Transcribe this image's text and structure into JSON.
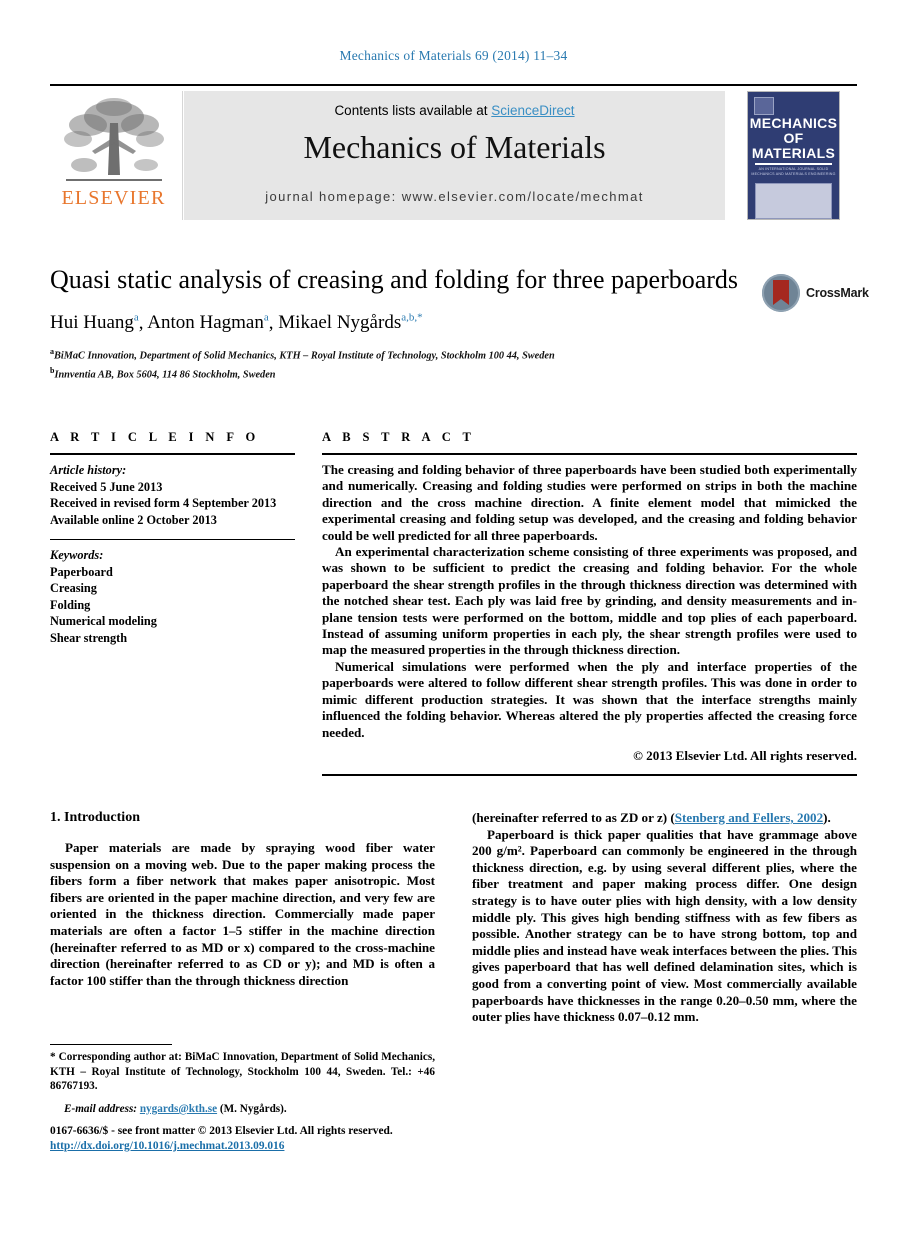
{
  "running_head": "Mechanics of Materials 69 (2014) 11–34",
  "masthead": {
    "contents_prefix": "Contents lists available at ",
    "sciencedirect": "ScienceDirect",
    "journal_title": "Mechanics of Materials",
    "homepage": "journal homepage: www.elsevier.com/locate/mechmat",
    "publisher_wordmark": "ELSEVIER",
    "cover": {
      "line1": "MECHANICS",
      "line2": "OF",
      "line3": "MATERIALS",
      "subtitle": "AN INTERNATIONAL JOURNAL\nSOLID MECHANICS AND MATERIALS ENGINEERING"
    }
  },
  "article": {
    "title": "Quasi static analysis of creasing and folding for three paperboards",
    "authors": [
      {
        "name": "Hui Huang",
        "marks": "a"
      },
      {
        "name": "Anton Hagman",
        "marks": "a"
      },
      {
        "name": "Mikael Nygårds",
        "marks": "a,b,*"
      }
    ],
    "affiliations": [
      {
        "mark": "a",
        "text": "BiMaC Innovation, Department of Solid Mechanics, KTH – Royal Institute of Technology, Stockholm 100 44, Sweden"
      },
      {
        "mark": "b",
        "text": "Innventia AB, Box 5604, 114 86 Stockholm, Sweden"
      }
    ],
    "crossmark_label": "CrossMark"
  },
  "info": {
    "heading": "A R T I C L E    I N F O",
    "history_label": "Article history:",
    "history": [
      "Received 5 June 2013",
      "Received in revised form 4 September 2013",
      "Available online 2 October 2013"
    ],
    "keywords_label": "Keywords:",
    "keywords": [
      "Paperboard",
      "Creasing",
      "Folding",
      "Numerical modeling",
      "Shear strength"
    ]
  },
  "abstract": {
    "heading": "A B S T R A C T",
    "paragraphs": [
      "The creasing and folding behavior of three paperboards have been studied both experimentally and numerically. Creasing and folding studies were performed on strips in both the machine direction and the cross machine direction. A finite element model that mimicked the experimental creasing and folding setup was developed, and the creasing and folding behavior could be well predicted for all three paperboards.",
      "An experimental characterization scheme consisting of three experiments was proposed, and was shown to be sufficient to predict the creasing and folding behavior. For the whole paperboard the shear strength profiles in the through thickness direction was determined with the notched shear test. Each ply was laid free by grinding, and density measurements and in-plane tension tests were performed on the bottom, middle and top plies of each paperboard. Instead of assuming uniform properties in each ply, the shear strength profiles were used to map the measured properties in the through thickness direction.",
      "Numerical simulations were performed when the ply and interface properties of the paperboards were altered to follow different shear strength profiles. This was done in order to mimic different production strategies. It was shown that the interface strengths mainly influenced the folding behavior. Whereas altered the ply properties affected the creasing force needed."
    ],
    "copyright": "© 2013 Elsevier Ltd. All rights reserved."
  },
  "body": {
    "section_title": "1. Introduction",
    "left_paragraph": "Paper materials are made by spraying wood fiber water suspension on a moving web. Due to the paper making process the fibers form a fiber network that makes paper anisotropic. Most fibers are oriented in the paper machine direction, and very few are oriented in the thickness direction. Commercially made paper materials are often a factor 1–5 stiffer in the machine direction (hereinafter referred to as MD or x) compared to the cross-machine direction (hereinafter referred to as CD or y); and MD is often a factor 100 stiffer than the through thickness direction",
    "right_paragraph_1_pre": "(hereinafter referred to as ZD or z) (",
    "right_paragraph_1_cite": "Stenberg and Fellers, 2002",
    "right_paragraph_1_post": ").",
    "right_paragraph_2": "Paperboard is thick paper qualities that have grammage above 200 g/m². Paperboard can commonly be engineered in the through thickness direction, e.g. by using several different plies, where the fiber treatment and paper making process differ. One design strategy is to have outer plies with high density, with a low density middle ply. This gives high bending stiffness with as few fibers as possible. Another strategy can be to have strong bottom, top and middle plies and instead have weak interfaces between the plies. This gives paperboard that has well defined delamination sites, which is good from a converting point of view. Most commercially available paperboards have thicknesses in the range 0.20–0.50 mm, where the outer plies have thickness 0.07–0.12 mm."
  },
  "footnote": {
    "corresponding": "* Corresponding author at: BiMaC Innovation, Department of Solid Mechanics, KTH – Royal Institute of Technology, Stockholm 100 44, Sweden. Tel.: +46 86767193.",
    "email_label": "E-mail address:",
    "email": "nygards@kth.se",
    "email_suffix": "(M. Nygårds)."
  },
  "imprint": {
    "line1": "0167-6636/$ - see front matter © 2013 Elsevier Ltd. All rights reserved.",
    "doi": "http://dx.doi.org/10.1016/j.mechmat.2013.09.016"
  },
  "colors": {
    "link": "#2a7ab0",
    "elsevier_orange": "#e8762d",
    "cover_navy": "#2f3d73",
    "masthead_gray": "#e6e6e6"
  }
}
